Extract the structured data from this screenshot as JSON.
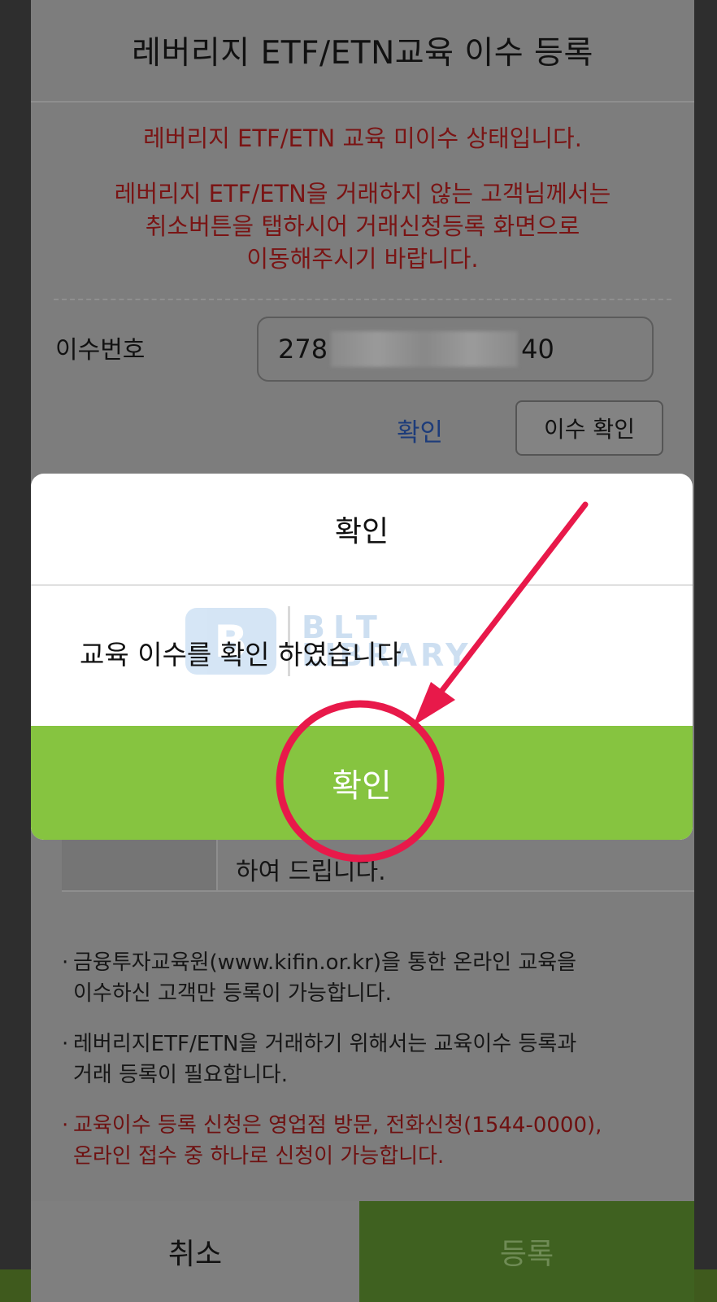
{
  "sheet": {
    "title": "레버리지 ETF/ETN교육 이수 등록",
    "warning_status": "레버리지 ETF/ETN 교육 미이수 상태입니다.",
    "warning_line1": "레버리지 ETF/ETN을 거래하지 않는 고객님께서는",
    "warning_line2": "취소버튼을 탭하시어 거래신청등록 화면으로",
    "warning_line3": "이동해주시기 바랍니다.",
    "cert_label": "이수번호",
    "cert_value_prefix": "278",
    "cert_value_suffix": "40",
    "confirm_link": "확인",
    "check_button": "이수 확인",
    "table_cell_text": "하여 드립니다.",
    "notes": [
      {
        "line1": "금융투자교육원(www.kifin.or.kr)을 통한 온라인 교육을",
        "line2": "이수하신 고객만 등록이 가능합니다."
      },
      {
        "line1": "레버리지ETF/ETN을 거래하기 위해서는 교육이수 등록과",
        "line2": "거래 등록이 필요합니다."
      },
      {
        "line1": "교육이수 등록 신청은 영업점 방문, 전화신청(1544-0000),",
        "line2": "온라인 접수 중 하나로 신청이 가능합니다."
      }
    ],
    "note_bullet": "·",
    "cancel_button": "취소",
    "register_button": "등록"
  },
  "modal": {
    "title": "확인",
    "message": "교육 이수를 확인 하였습니다",
    "ok_button": "확인"
  },
  "watermark": {
    "logo_letter": "B",
    "line1": "BLT",
    "line2": "LIBRARY"
  },
  "colors": {
    "modal_ok_green": "#86c440",
    "warning_red": "#7a1414",
    "annotation_red": "#e8194a"
  }
}
